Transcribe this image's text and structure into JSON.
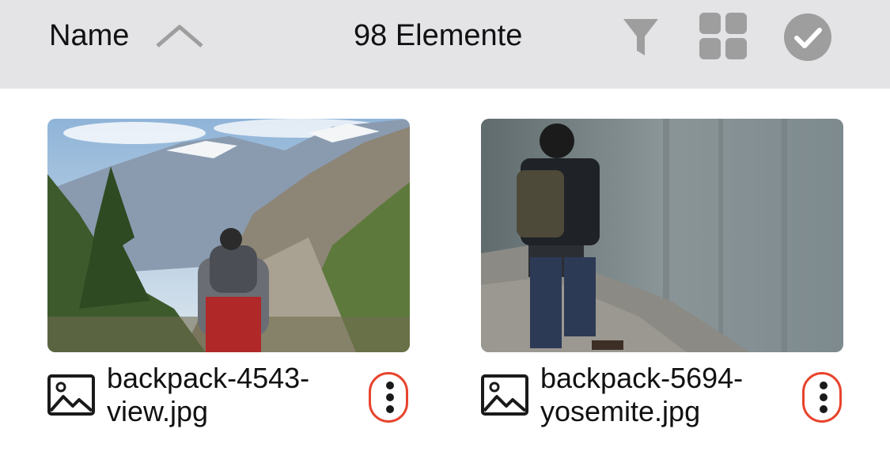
{
  "toolbar": {
    "sort_label": "Name",
    "sort_direction_icon": "chevron-up-icon",
    "item_count": "98 Elemente",
    "filter_icon": "filter-icon",
    "view_icon": "grid-view-icon",
    "select_icon": "select-check-icon"
  },
  "files": [
    {
      "name_line1": "backpack-4543-",
      "name_line2": "view.jpg",
      "type_icon": "image-file-icon",
      "menu_icon": "more-vertical-icon"
    },
    {
      "name_line1": "backpack-5694-",
      "name_line2": "yosemite.jpg",
      "type_icon": "image-file-icon",
      "menu_icon": "more-vertical-icon"
    }
  ],
  "colors": {
    "toolbar_bg": "#e4e4e7",
    "icon_gray": "#9e9e9e",
    "highlight_red": "#e8442d"
  }
}
